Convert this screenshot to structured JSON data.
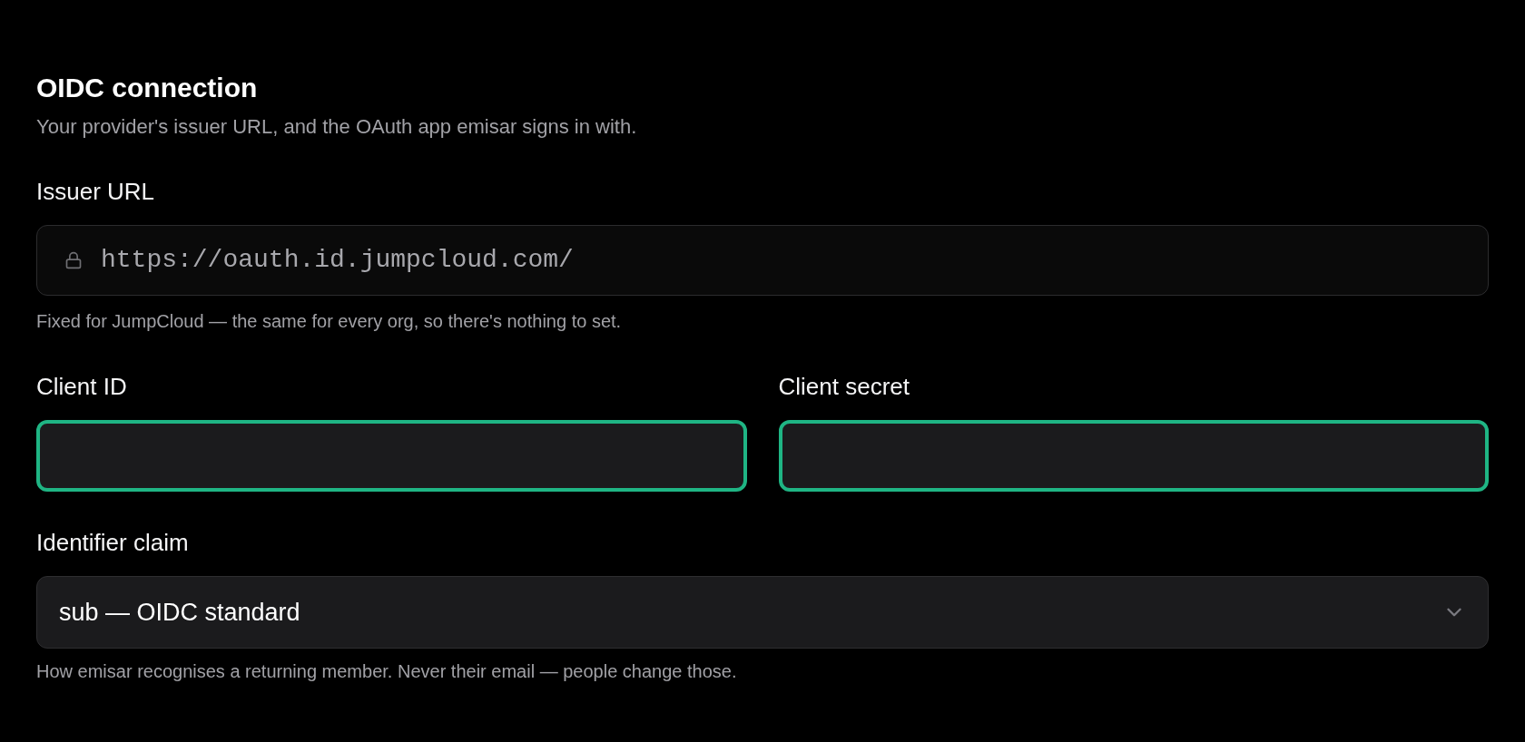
{
  "section": {
    "title": "OIDC connection",
    "description": "Your provider's issuer URL, and the OAuth app emisar signs in with."
  },
  "issuer_url": {
    "label": "Issuer URL",
    "value": "https://oauth.id.jumpcloud.com/",
    "locked": true,
    "help": "Fixed for JumpCloud — the same for every org, so there's nothing to set."
  },
  "credentials": [
    {
      "label": "Client ID",
      "highlighted": true
    },
    {
      "label": "Client secret",
      "highlighted": true
    }
  ],
  "identifier_claim": {
    "label": "Identifier claim",
    "value": "sub — OIDC standard",
    "help": "How emisar recognises a returning member. Never their email — people change those."
  }
}
